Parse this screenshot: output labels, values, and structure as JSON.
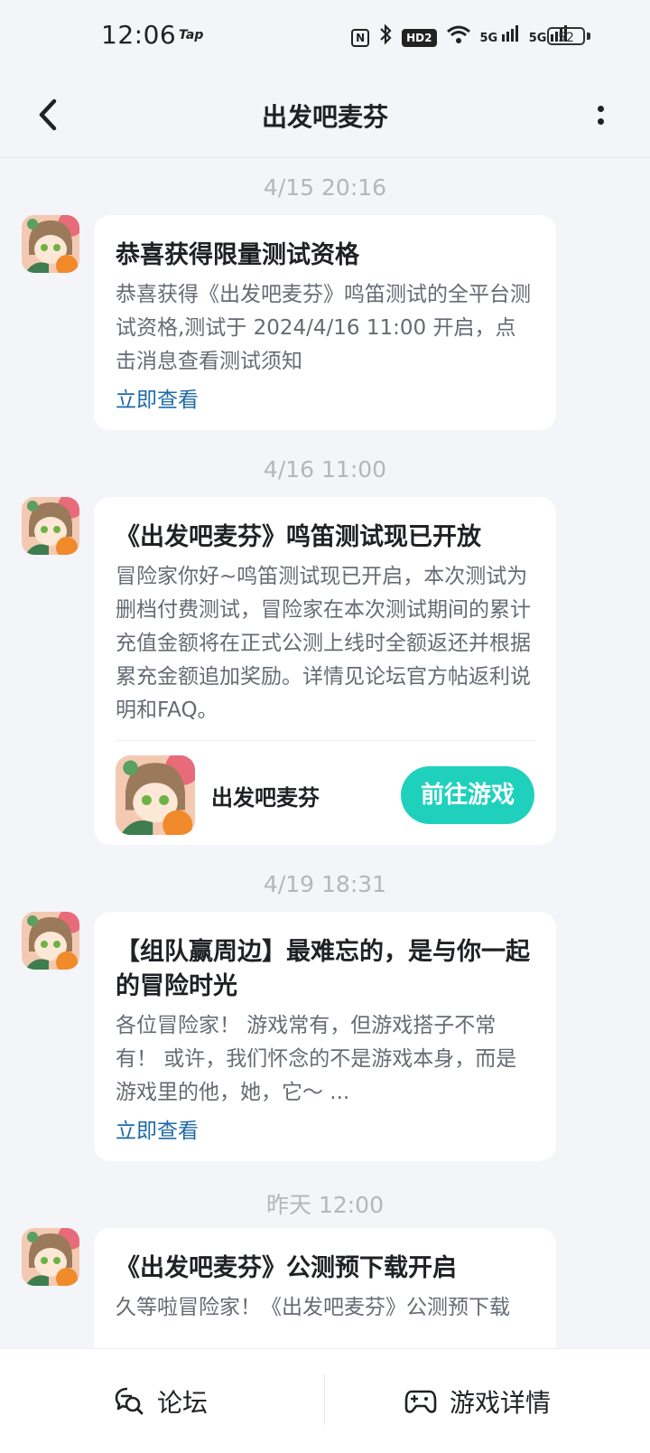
{
  "status_bar": {
    "time": "12:06",
    "app_badge": "Tap",
    "nfc": "N",
    "hd": "HD2",
    "net1": "5G",
    "net2": "5G",
    "battery": "52"
  },
  "header": {
    "title": "出发吧麦芬"
  },
  "messages": [
    {
      "timestamp": "4/15  20:16",
      "title": "恭喜获得限量测试资格",
      "body": "恭喜获得《出发吧麦芬》鸣笛测试的全平台测试资格,测试于 2024/4/16 11:00 开启，点击消息查看测试须知",
      "link": "立即查看"
    },
    {
      "timestamp": "4/16  11:00",
      "title": "《出发吧麦芬》鸣笛测试现已开放",
      "body": "冒险家你好~鸣笛测试现已开启，本次测试为删档付费测试，冒险家在本次测试期间的累计充值金额将在正式公测上线时全额返还并根据累充金额追加奖励。详情见论坛官方帖返利说明和FAQ。",
      "game_name": "出发吧麦芬",
      "play_button": "前往游戏"
    },
    {
      "timestamp": "4/19  18:31",
      "title": "【组队赢周边】最难忘的，是与你一起的冒险时光",
      "body": "各位冒险家！ 游戏常有，但游戏搭子不常有！ 或许，我们怀念的不是游戏本身，而是游戏里的他，她，它～ ...",
      "link": "立即查看"
    },
    {
      "timestamp": "昨天  12:00",
      "title": "《出发吧麦芬》公测预下载开启",
      "body": "久等啦冒险家！《出发吧麦芬》公测预下载"
    }
  ],
  "bottom_bar": {
    "forum": "论坛",
    "game_details": "游戏详情"
  },
  "colors": {
    "accent": "#1fd1bd",
    "link": "#1f6aa8",
    "background": "#f3f5f8"
  }
}
